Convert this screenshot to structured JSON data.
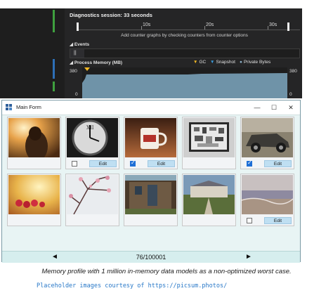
{
  "diagnostics": {
    "session_label": "Diagnostics session: 33 seconds",
    "timeline_ticks": [
      "10s",
      "20s",
      "30s"
    ],
    "hint": "Add counter graphs by checking counters from counter options",
    "events_header": "Events",
    "pause_icon": "||",
    "process_memory_header": "Process Memory (MB)",
    "legend": [
      {
        "label": "GC",
        "icon": "gc-marker-icon",
        "color": "#f2b824"
      },
      {
        "label": "Snapshot",
        "icon": "snapshot-marker-icon",
        "color": "#3a9ad9"
      },
      {
        "label": "Private Bytes",
        "icon": "private-bytes-dot-icon",
        "color": "#8fb4cc"
      }
    ],
    "y_max_left": "380",
    "y_min_left": "0",
    "y_max_right": "380",
    "y_min_right": "0",
    "memory_fill_color": "#6f93a8"
  },
  "window": {
    "title": "Main Form",
    "minimize": "—",
    "maximize": "☐",
    "close": "✕"
  },
  "tiles": [
    {
      "name": "tile-girl-sunset",
      "has_controls": false
    },
    {
      "name": "tile-clock",
      "has_controls": true,
      "checked": false,
      "edit_label": "Edit"
    },
    {
      "name": "tile-coffee-mug",
      "has_controls": true,
      "checked": true,
      "edit_label": "Edit"
    },
    {
      "name": "tile-desk-flatlay",
      "has_controls": false
    },
    {
      "name": "tile-vintage-car",
      "has_controls": true,
      "checked": true,
      "edit_label": "Edit"
    },
    {
      "name": "tile-berries",
      "has_controls": false
    },
    {
      "name": "tile-blossom-tree",
      "has_controls": false
    },
    {
      "name": "tile-wooden-shed",
      "has_controls": false
    },
    {
      "name": "tile-chateau",
      "has_controls": false
    },
    {
      "name": "tile-beach",
      "has_controls": true,
      "checked": false,
      "edit_label": "Edit"
    }
  ],
  "pager": {
    "prev_icon": "◄",
    "next_icon": "►",
    "count": "76/100001"
  },
  "caption": "Memory profile with 1 million in-memory data models as a non-optimized worst case.",
  "credit": "Placeholder images courtesy of https://picsum.photos/"
}
